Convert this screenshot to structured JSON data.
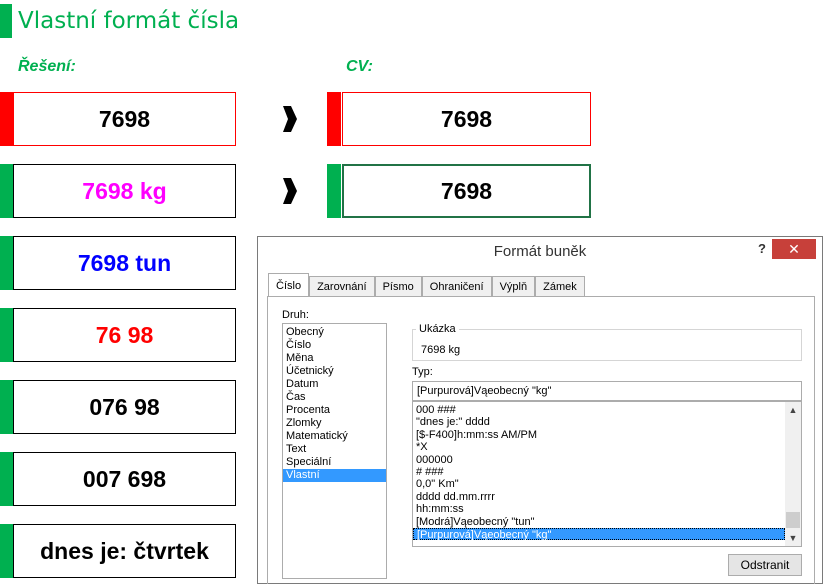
{
  "sheet": {
    "title": "Vlastní formát čísla",
    "solution_label": "Řešení:",
    "exercise_label": "CV:",
    "solutions": [
      {
        "text": "7698",
        "text_color": "#000000",
        "strip_color": "#ff0000"
      },
      {
        "text": "7698 kg",
        "text_color": "#ff00ff",
        "strip_color": "#00b050"
      },
      {
        "text": "7698 tun",
        "text_color": "#0000ff",
        "strip_color": "#00b050"
      },
      {
        "text": "76 98",
        "text_color": "#ff0000",
        "strip_color": "#00b050"
      },
      {
        "text": "076 98",
        "text_color": "#000000",
        "strip_color": "#00b050"
      },
      {
        "text": "007 698",
        "text_color": "#000000",
        "strip_color": "#00b050"
      },
      {
        "text": "dnes je: čtvrtek",
        "text_color": "#000000",
        "strip_color": "#00b050"
      }
    ],
    "exercises": [
      {
        "text": "7698",
        "strip_color": "#ff0000"
      },
      {
        "text": "7698",
        "strip_color": "#00b050"
      }
    ]
  },
  "dialog": {
    "title": "Formát buněk",
    "help_label": "?",
    "close_label": "✕",
    "tabs": [
      "Číslo",
      "Zarovnání",
      "Písmo",
      "Ohraničení",
      "Výplň",
      "Zámek"
    ],
    "category_label": "Druh:",
    "categories": [
      "Obecný",
      "Číslo",
      "Měna",
      "Účetnický",
      "Datum",
      "Čas",
      "Procenta",
      "Zlomky",
      "Matematický",
      "Text",
      "Speciální",
      "Vlastní"
    ],
    "selected_category": 11,
    "sample_label": "Ukázka",
    "sample_value": "7698 kg",
    "type_label": "Typ:",
    "type_value": "[Purpurová]Vąeobecný \"kg\"",
    "formats": [
      "000 ###",
      "\"dnes je:\" dddd",
      "[$-F400]h:mm:ss AM/PM",
      "*X",
      "000000",
      "# ###",
      "0,0\" Km\"",
      "dddd dd.mm.rrrr",
      "hh:mm:ss",
      "[Modrá]Vąeobecný \"tun\"",
      "[Purpurová]Vąeobecný \"kg\""
    ],
    "selected_format": 10,
    "remove_label": "Odstranit"
  }
}
